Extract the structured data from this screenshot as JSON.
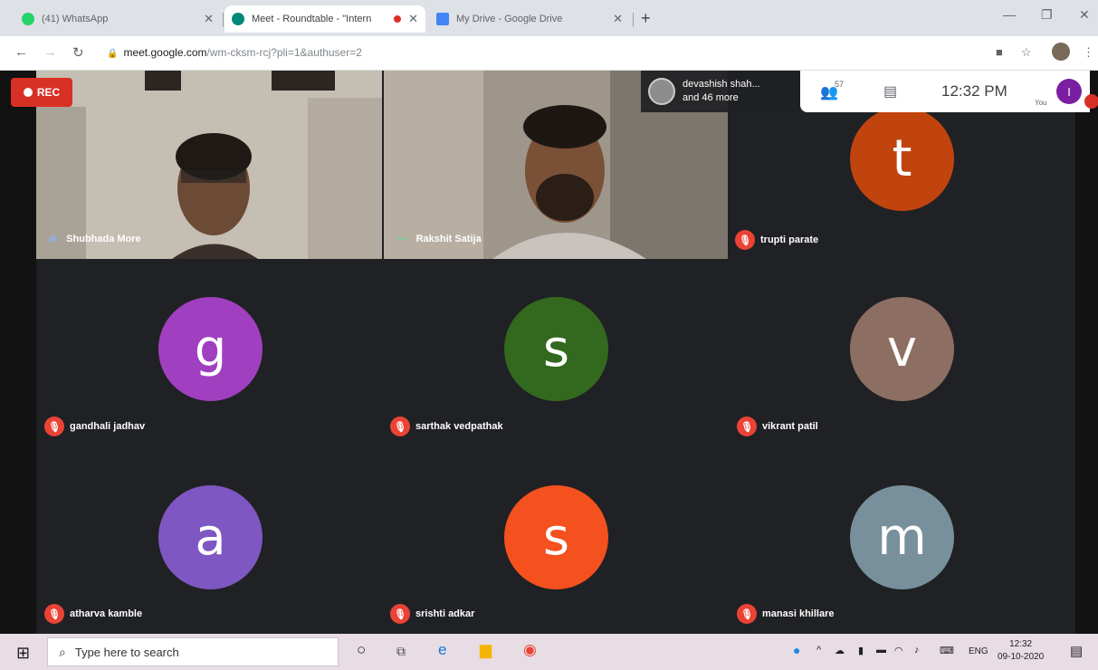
{
  "browser": {
    "tabs": [
      {
        "title": "(41) WhatsApp",
        "icon": "whatsapp-icon",
        "color": "#25d366"
      },
      {
        "title": "Meet - Roundtable - \"Intern",
        "icon": "meet-icon",
        "color": "#00897b",
        "recording": true
      },
      {
        "title": "My Drive - Google Drive",
        "icon": "drive-icon",
        "color": "#4285f4"
      }
    ],
    "url_host": "meet.google.com",
    "url_path": "/wm-cksm-rcj?pli=1&authuser=2"
  },
  "meet": {
    "rec_label": "REC",
    "presenter": {
      "line1": "devashish shah...",
      "line2": "and 46 more"
    },
    "participant_count": "57",
    "time": "12:32 PM",
    "you_label": "You",
    "self_initial": "I",
    "participants": [
      {
        "name": "Shubhada More",
        "type": "video"
      },
      {
        "name": "Rakshit Satija",
        "type": "video"
      },
      {
        "name": "trupti parate",
        "initial": "t",
        "color": "#c1440e"
      },
      {
        "name": "gandhali jadhav",
        "initial": "g",
        "color": "#a040c0"
      },
      {
        "name": "sarthak vedpathak",
        "initial": "s",
        "color": "#33691e"
      },
      {
        "name": "vikrant patil",
        "initial": "v",
        "color": "#8d6e63"
      },
      {
        "name": "atharva kamble",
        "initial": "a",
        "color": "#7e57c2"
      },
      {
        "name": "srishti adkar",
        "initial": "s",
        "color": "#f4511e"
      },
      {
        "name": "manasi khillare",
        "initial": "m",
        "color": "#78909c"
      }
    ]
  },
  "taskbar": {
    "search_placeholder": "Type here to search",
    "lang": "ENG",
    "time": "12:32",
    "date": "09-10-2020"
  }
}
